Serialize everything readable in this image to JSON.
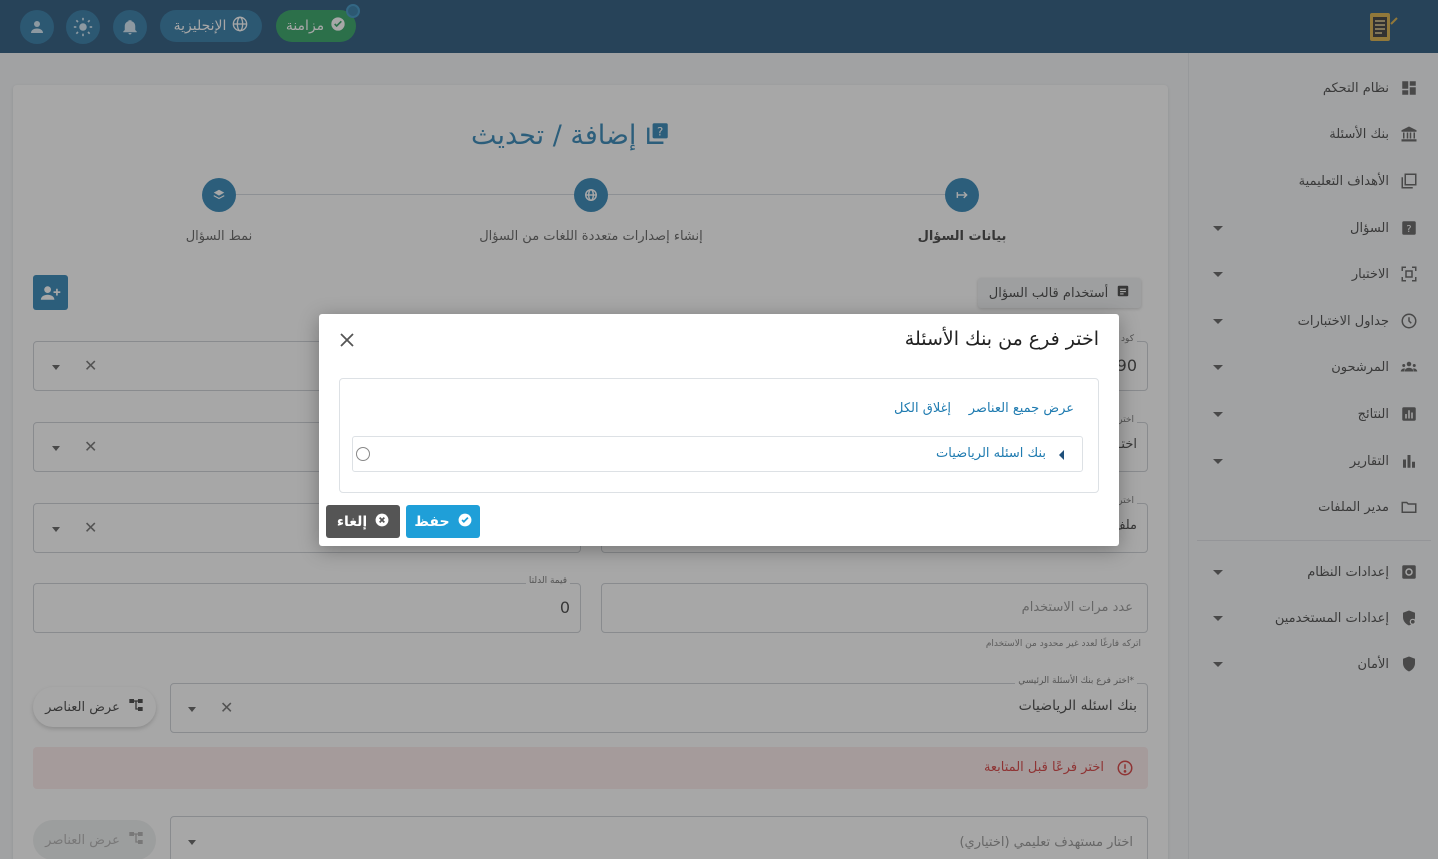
{
  "topbar": {
    "sync_label": "مزامنة",
    "language_label": "الإنجليزية",
    "icons": [
      "user-icon",
      "sun-icon",
      "bell-icon",
      "globe-icon",
      "check-circle-icon"
    ]
  },
  "sidebar": {
    "items": [
      {
        "label": "نظام التحكم",
        "icon": "dashboard-icon",
        "dropdown": false
      },
      {
        "label": "بنك الأسئلة",
        "icon": "bank-icon",
        "dropdown": false
      },
      {
        "label": "الأهداف التعليمية",
        "icon": "quiz-icon",
        "dropdown": false
      },
      {
        "label": "السؤال",
        "icon": "help-icon",
        "dropdown": true
      },
      {
        "label": "الاختبار",
        "icon": "exam-icon",
        "dropdown": true
      },
      {
        "label": "جداول الاختبارات",
        "icon": "clock-icon",
        "dropdown": true
      },
      {
        "label": "المرشحون",
        "icon": "people-icon",
        "dropdown": true
      },
      {
        "label": "النتائج",
        "icon": "chart-icon",
        "dropdown": true
      },
      {
        "label": "التقارير",
        "icon": "bar-chart-icon",
        "dropdown": true
      },
      {
        "label": "مدير الملفات",
        "icon": "folder-icon",
        "dropdown": false
      },
      {
        "label": "إعدادات النظام",
        "icon": "settings-icon",
        "dropdown": true
      },
      {
        "label": "إعدادات المستخدمين",
        "icon": "user-shield-icon",
        "dropdown": true
      },
      {
        "label": "الأمان",
        "icon": "shield-icon",
        "dropdown": true
      }
    ]
  },
  "page": {
    "title": "إضافة / تحديث",
    "steps": [
      {
        "label": "بيانات السؤال"
      },
      {
        "label": "إنشاء إصدارات متعددة اللغات من السؤال"
      },
      {
        "label": "نمط السؤال"
      }
    ],
    "template_button": "أستخدام قالب السؤال",
    "fields": {
      "row1_value": "90",
      "row1_label": "كود",
      "row2_value": "اختـ",
      "row2_label": "اختر",
      "row3_value": "ملف",
      "row3_label": "اختر",
      "delta_label": "قيمة الدلتا",
      "delta_value": "0",
      "usage_placeholder": "عدد مرات الاستخدام",
      "usage_hint": "اتركه فارغًا لعدد غير محدود من الاستخدام",
      "bank_label": "اختر فرع بنك الأسئلة الرئيسي*",
      "bank_value": "بنك اسئله الرياضيات",
      "objective_placeholder": "اختار مستهدف تعليمي (اختياري)"
    },
    "show_items_button": "عرض العناصر",
    "show_items_button_disabled": "عرض العناصر",
    "alert_text": "اختر فرعًا قبل المتابعة"
  },
  "dialog": {
    "title": "اختر فرع من بنك الأسئلة",
    "show_all": "عرض جميع العناصر",
    "collapse_all": "إغلاق الكل",
    "tree_item": "بنك اسئله الرياضيات",
    "save_label": "حفظ",
    "cancel_label": "إلغاء"
  },
  "colors": {
    "topbar": "#164a72",
    "accent": "#1f7bb0",
    "save": "#1f9fd8",
    "sync": "#1f9b57",
    "alert": "#d32f2f"
  }
}
